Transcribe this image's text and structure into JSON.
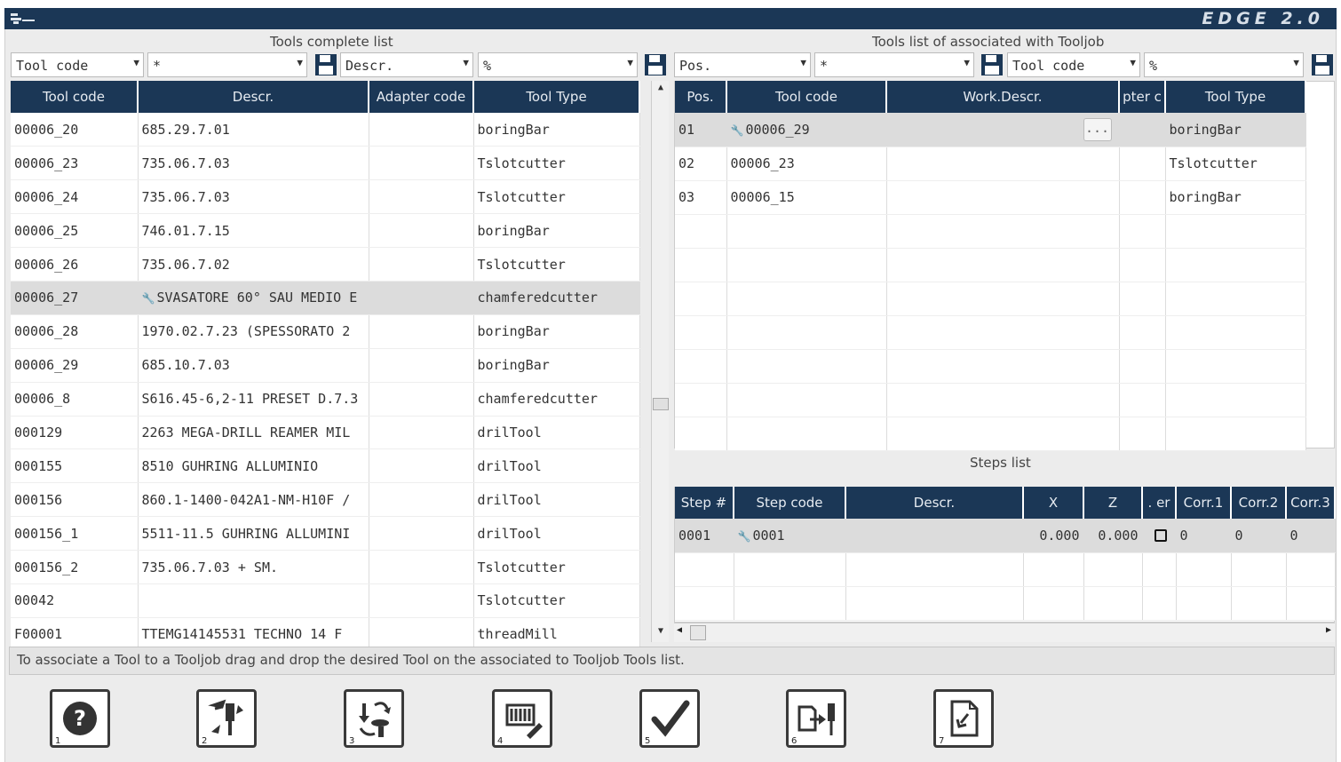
{
  "app": {
    "logo": "EDGE 2.0"
  },
  "left": {
    "title": "Tools complete list",
    "filters": {
      "field1": "Tool code",
      "value1": "*",
      "field2": "Descr.",
      "value2": "%"
    },
    "columns": [
      "Tool code",
      "Descr.",
      "Adapter code",
      "Tool Type"
    ],
    "rows": [
      {
        "code": "00006_20",
        "descr": "685.29.7.01",
        "adapter": "",
        "type": "boringBar"
      },
      {
        "code": "00006_23",
        "descr": "735.06.7.03",
        "adapter": "",
        "type": "Tslotcutter"
      },
      {
        "code": "00006_24",
        "descr": "735.06.7.03",
        "adapter": "",
        "type": "Tslotcutter"
      },
      {
        "code": "00006_25",
        "descr": "746.01.7.15",
        "adapter": "",
        "type": "boringBar"
      },
      {
        "code": "00006_26",
        "descr": "735.06.7.02",
        "adapter": "",
        "type": "Tslotcutter"
      },
      {
        "code": "00006_27",
        "descr": "SVASATORE 60° SAU MEDIO E",
        "adapter": "",
        "type": "chamferedcutter"
      },
      {
        "code": "00006_28",
        "descr": "1970.02.7.23 (SPESSORATO 2",
        "adapter": "",
        "type": "boringBar"
      },
      {
        "code": "00006_29",
        "descr": "685.10.7.03",
        "adapter": "",
        "type": "boringBar"
      },
      {
        "code": "00006_8",
        "descr": "S616.45-6,2-11 PRESET D.7.3",
        "adapter": "",
        "type": "chamferedcutter"
      },
      {
        "code": "000129",
        "descr": "2263 MEGA-DRILL REAMER MIL",
        "adapter": "",
        "type": "drilTool"
      },
      {
        "code": "000155",
        "descr": "8510 GUHRING ALLUMINIO",
        "adapter": "",
        "type": "drilTool"
      },
      {
        "code": "000156",
        "descr": "860.1-1400-042A1-NM-H10F /",
        "adapter": "",
        "type": "drilTool"
      },
      {
        "code": "000156_1",
        "descr": "5511-11.5 GUHRING ALLUMINI",
        "adapter": "",
        "type": "drilTool"
      },
      {
        "code": "000156_2",
        "descr": "735.06.7.03 + SM.",
        "adapter": "",
        "type": "Tslotcutter"
      },
      {
        "code": "00042",
        "descr": "",
        "adapter": "",
        "type": "Tslotcutter"
      },
      {
        "code": "F00001",
        "descr": "TTEMG14145531 TECHNO 14 F",
        "adapter": "",
        "type": "threadMill"
      }
    ]
  },
  "right": {
    "title": "Tools list of associated with Tooljob",
    "filters": {
      "field1": "Pos.",
      "value1": "*",
      "field2": "Tool code",
      "value2": "%"
    },
    "columns": [
      "Pos.",
      "Tool code",
      "Work.Descr.",
      "pter c",
      "Tool Type"
    ],
    "rows": [
      {
        "pos": "01",
        "code": "00006_29",
        "work": "",
        "adapter": "",
        "type": "boringBar",
        "button": "..."
      },
      {
        "pos": "02",
        "code": "00006_23",
        "work": "",
        "adapter": "",
        "type": "Tslotcutter"
      },
      {
        "pos": "03",
        "code": "00006_15",
        "work": "",
        "adapter": "",
        "type": "boringBar"
      }
    ]
  },
  "steps": {
    "title": "Steps list",
    "columns": [
      "Step #",
      "Step code",
      "Descr.",
      "X",
      "Z",
      ". er",
      "Corr.1",
      "Corr.2",
      "Corr.3"
    ],
    "rows": [
      {
        "step": "0001",
        "code": "0001",
        "descr": "",
        "x": "0.000",
        "z": "0.000",
        "corr1": "0",
        "corr2": "0",
        "corr3": "0"
      }
    ]
  },
  "status": "To associate a Tool to a Tooljob drag and drop the desired Tool on the associated to Tooljob Tools list.",
  "toolbar": [
    {
      "num": "1",
      "icon": "help-icon"
    },
    {
      "num": "2",
      "icon": "tool-swap-icon"
    },
    {
      "num": "3",
      "icon": "tool-exchange-icon"
    },
    {
      "num": "4",
      "icon": "tool-edit-icon"
    },
    {
      "num": "5",
      "icon": "confirm-check-icon"
    },
    {
      "num": "6",
      "icon": "tool-export-icon"
    },
    {
      "num": "7",
      "icon": "document-return-icon"
    }
  ],
  "colors": {
    "header": "#1b3756",
    "selected_row": "#dcdcdc",
    "wrench": "#2e9b3a"
  }
}
